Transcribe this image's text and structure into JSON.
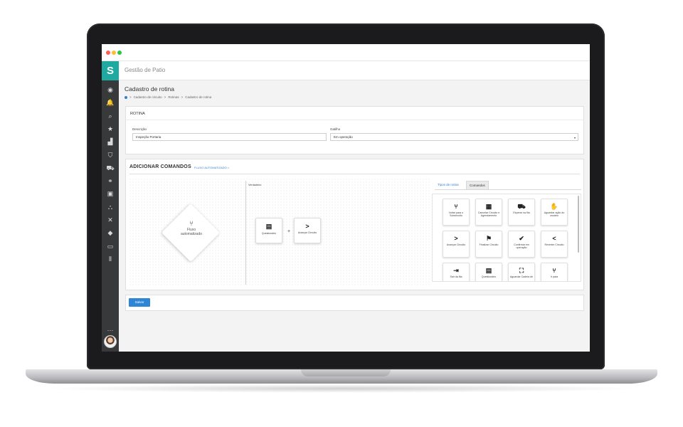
{
  "colors": {
    "accent": "#2f86d6",
    "brand_teal": "#1fa9a0",
    "sidebar_bg": "#37393b"
  },
  "browser": {
    "dots": [
      "#ff5f57",
      "#febc2e",
      "#28c840"
    ]
  },
  "sidebar": {
    "logo": "S",
    "items": [
      {
        "icon": "user-circle-icon",
        "glyph": "◉"
      },
      {
        "icon": "bell-icon",
        "glyph": "🔔"
      },
      {
        "icon": "search-icon",
        "glyph": "⌕"
      },
      {
        "icon": "star-icon",
        "glyph": "★"
      },
      {
        "icon": "chart-icon",
        "glyph": "▟"
      },
      {
        "icon": "shield-icon",
        "glyph": "⛉"
      },
      {
        "icon": "truck-icon",
        "glyph": "⛟"
      },
      {
        "icon": "handshake-icon",
        "glyph": "⚭"
      },
      {
        "icon": "briefcase-icon",
        "glyph": "▣"
      },
      {
        "icon": "tag-icon",
        "glyph": "⛬"
      },
      {
        "icon": "tools-icon",
        "glyph": "✕"
      },
      {
        "icon": "diamond-icon",
        "glyph": "◆"
      },
      {
        "icon": "monitor-icon",
        "glyph": "▭"
      },
      {
        "icon": "columns-icon",
        "glyph": "⦀"
      },
      {
        "icon": "more-icon",
        "glyph": "···"
      }
    ]
  },
  "header": {
    "title": "Gestão de Patio"
  },
  "page": {
    "title": "Cadastro de rotina",
    "breadcrumb": [
      ">",
      "Cadastro de circuito",
      ">",
      "Rotinas",
      ">",
      "Cadastro de rotina"
    ]
  },
  "rotina": {
    "section": "ROTINA",
    "descricao_label": "Descrição",
    "descricao_value": "Inspeção Portaria",
    "gatilho_label": "Gatilho",
    "gatilho_value": "Em operação",
    "caret": "▾"
  },
  "comandos": {
    "title": "ADICIONAR COMANDOS",
    "link": "FLUXO AUTOMATIZADO >",
    "diamond_line1": "Fluxo",
    "diamond_line2": "automatizado",
    "verdadeiro_label": "Verdadeiro",
    "nodes": [
      {
        "icon": "questionnaire-icon",
        "glyph": "▤",
        "label": "Questionário"
      },
      {
        "icon": "chevron-right-icon",
        "glyph": ">",
        "label": "Avançar Circuito"
      }
    ],
    "plus": "+",
    "tabs": [
      {
        "label": "Tipos de rotina",
        "active": false
      },
      {
        "label": "Comandos",
        "active": true
      }
    ],
    "cards": [
      {
        "icon": "branch-icon",
        "glyph": "⑂",
        "label": "Voltar para o Subcircuito"
      },
      {
        "icon": "calendar-x-icon",
        "glyph": "▦",
        "label": "Cancelar Circuito e Agendamento"
      },
      {
        "icon": "truck-icon",
        "glyph": "⛟",
        "label": "Esperar na fila"
      },
      {
        "icon": "hand-icon",
        "glyph": "✋",
        "label": "Aguardar ação do usuário"
      },
      {
        "icon": "chevron-right-icon",
        "glyph": ">",
        "label": "Avançar Circuito"
      },
      {
        "icon": "flag-icon",
        "glyph": "⚑",
        "label": "Finalizar Circuito"
      },
      {
        "icon": "check-circle-icon",
        "glyph": "✔",
        "label": "Confirmar em operação"
      },
      {
        "icon": "chevron-left-icon",
        "glyph": "<",
        "label": "Reverter Circuito"
      },
      {
        "icon": "exit-icon",
        "glyph": "⇥",
        "label": "Sair da fila"
      },
      {
        "icon": "questionnaire-icon",
        "glyph": "▤",
        "label": "Questionário"
      },
      {
        "icon": "binoculars-icon",
        "glyph": "⛶",
        "label": "Aguardar Cadeia de"
      },
      {
        "icon": "branch-icon",
        "glyph": "⑂",
        "label": "Ir para"
      }
    ]
  },
  "footer": {
    "save_label": "Salvar"
  }
}
